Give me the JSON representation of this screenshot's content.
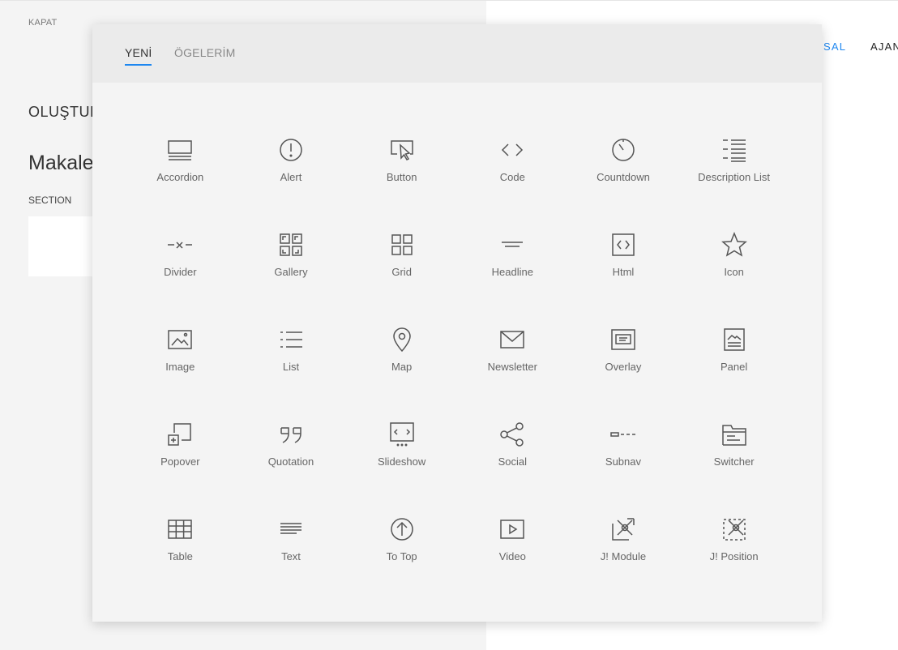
{
  "left": {
    "close": "KAPAT",
    "heading": "OLUŞTUR",
    "title": "Makale",
    "section": "SECTION"
  },
  "site_nav": {
    "active_item": "MSAL",
    "next_item": "AJAN"
  },
  "modal": {
    "tabs": [
      {
        "label": "YENİ",
        "active": true
      },
      {
        "label": "ÖGELERİM",
        "active": false
      }
    ],
    "elements": [
      {
        "label": "Accordion",
        "icon": "accordion-icon"
      },
      {
        "label": "Alert",
        "icon": "alert-icon"
      },
      {
        "label": "Button",
        "icon": "button-icon"
      },
      {
        "label": "Code",
        "icon": "code-icon"
      },
      {
        "label": "Countdown",
        "icon": "countdown-icon"
      },
      {
        "label": "Description List",
        "icon": "description-list-icon"
      },
      {
        "label": "Divider",
        "icon": "divider-icon"
      },
      {
        "label": "Gallery",
        "icon": "gallery-icon"
      },
      {
        "label": "Grid",
        "icon": "grid-icon"
      },
      {
        "label": "Headline",
        "icon": "headline-icon"
      },
      {
        "label": "Html",
        "icon": "html-icon"
      },
      {
        "label": "Icon",
        "icon": "star-icon"
      },
      {
        "label": "Image",
        "icon": "image-icon"
      },
      {
        "label": "List",
        "icon": "list-icon"
      },
      {
        "label": "Map",
        "icon": "map-pin-icon"
      },
      {
        "label": "Newsletter",
        "icon": "envelope-icon"
      },
      {
        "label": "Overlay",
        "icon": "overlay-icon"
      },
      {
        "label": "Panel",
        "icon": "panel-icon"
      },
      {
        "label": "Popover",
        "icon": "popover-icon"
      },
      {
        "label": "Quotation",
        "icon": "quotation-icon"
      },
      {
        "label": "Slideshow",
        "icon": "slideshow-icon"
      },
      {
        "label": "Social",
        "icon": "social-icon"
      },
      {
        "label": "Subnav",
        "icon": "subnav-icon"
      },
      {
        "label": "Switcher",
        "icon": "switcher-icon"
      },
      {
        "label": "Table",
        "icon": "table-icon"
      },
      {
        "label": "Text",
        "icon": "text-icon"
      },
      {
        "label": "To Top",
        "icon": "to-top-icon"
      },
      {
        "label": "Video",
        "icon": "video-icon"
      },
      {
        "label": "J! Module",
        "icon": "joomla-module-icon"
      },
      {
        "label": "J! Position",
        "icon": "joomla-position-icon"
      }
    ]
  },
  "colors": {
    "accent": "#1e87f0"
  }
}
